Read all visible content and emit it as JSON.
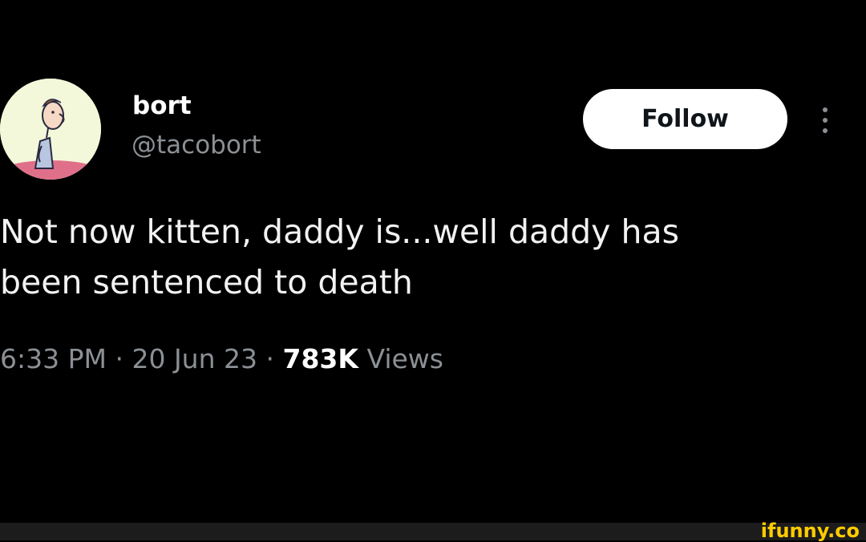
{
  "tweet": {
    "display_name": "bort",
    "handle": "@tacobort",
    "follow_label": "Follow",
    "text_lines": [
      "Not now kitten, daddy is...well daddy has",
      "been sentenced to death"
    ],
    "time": "6:33 PM",
    "date": "20 Jun 23",
    "separator": "·",
    "views_count": "783K",
    "views_label": "Views"
  },
  "watermark": {
    "text": "ifunny.co"
  },
  "colors": {
    "background": "#000000",
    "primary_text": "#e7e9ea",
    "secondary_text": "#8b9095",
    "follow_button_bg": "#ffffff",
    "watermark": "#ffcc00"
  },
  "icons": {
    "more": "more-vertical-icon",
    "avatar": "avatar-image"
  }
}
